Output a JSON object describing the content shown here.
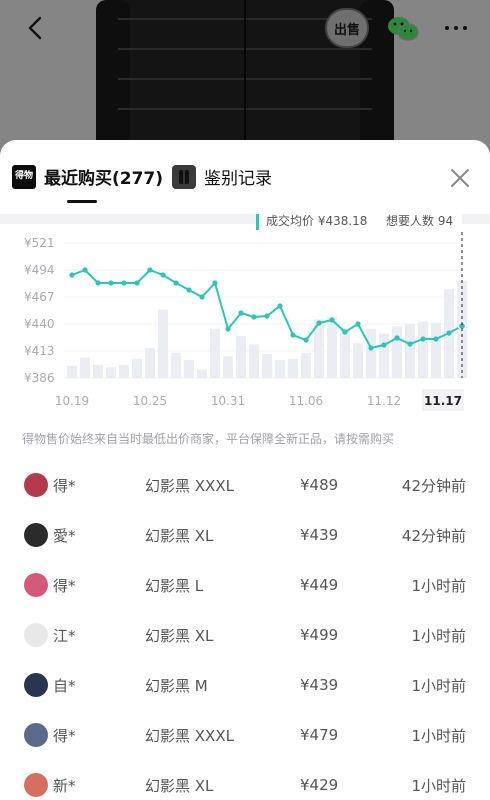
{
  "header": {
    "sell_badge": "出售"
  },
  "tabs": [
    {
      "label": "最近购买(277)",
      "logo": "得物"
    },
    {
      "label": "鉴别记录"
    }
  ],
  "chart_data": {
    "type": "line",
    "tooltip": {
      "avg_label": "成交均价 ¥438.18",
      "want_label": "想要人数 94"
    },
    "y_ticks": [
      "¥521",
      "¥494",
      "¥467",
      "¥440",
      "¥413",
      "¥386"
    ],
    "ylim": [
      386,
      521
    ],
    "x_ticks": [
      "10.19",
      "10.25",
      "10.31",
      "11.06",
      "11.12",
      "11.17"
    ],
    "line_values": [
      489,
      494,
      481,
      481,
      481,
      481,
      494,
      489,
      481,
      474,
      467,
      481,
      435,
      451,
      447,
      448,
      458,
      429,
      424,
      441,
      444,
      432,
      440,
      416,
      419,
      426,
      420,
      425,
      425,
      431,
      438
    ],
    "bar_values": [
      0.1,
      0.17,
      0.11,
      0.09,
      0.11,
      0.16,
      0.25,
      0.57,
      0.21,
      0.15,
      0.07,
      0.41,
      0.18,
      0.35,
      0.28,
      0.2,
      0.15,
      0.16,
      0.21,
      0.49,
      0.51,
      0.41,
      0.29,
      0.41,
      0.37,
      0.43,
      0.45,
      0.47,
      0.46,
      0.74,
      0.81
    ]
  },
  "notice": "得物售价始终来自当时最低出价商家，平台保障全新正品，请按需购买",
  "records": [
    {
      "user": "得*",
      "size": "幻影黑 XXXL",
      "price": "¥489",
      "time": "42分钟前",
      "avatar_color": "#b33a4a"
    },
    {
      "user": "愛*",
      "size": "幻影黑 XL",
      "price": "¥439",
      "time": "42分钟前",
      "avatar_color": "#2b2b2b"
    },
    {
      "user": "得*",
      "size": "幻影黑 L",
      "price": "¥449",
      "time": "1小时前",
      "avatar_color": "#d55a7a"
    },
    {
      "user": "江*",
      "size": "幻影黑 XL",
      "price": "¥499",
      "time": "1小时前",
      "avatar_color": "#e8e8e8"
    },
    {
      "user": "自*",
      "size": "幻影黑 M",
      "price": "¥439",
      "time": "1小时前",
      "avatar_color": "#2a3550"
    },
    {
      "user": "得*",
      "size": "幻影黑 XXXL",
      "price": "¥479",
      "time": "1小时前",
      "avatar_color": "#5a6a8a"
    },
    {
      "user": "新*",
      "size": "幻影黑 XL",
      "price": "¥429",
      "time": "1小时前",
      "avatar_color": "#d47060"
    }
  ]
}
